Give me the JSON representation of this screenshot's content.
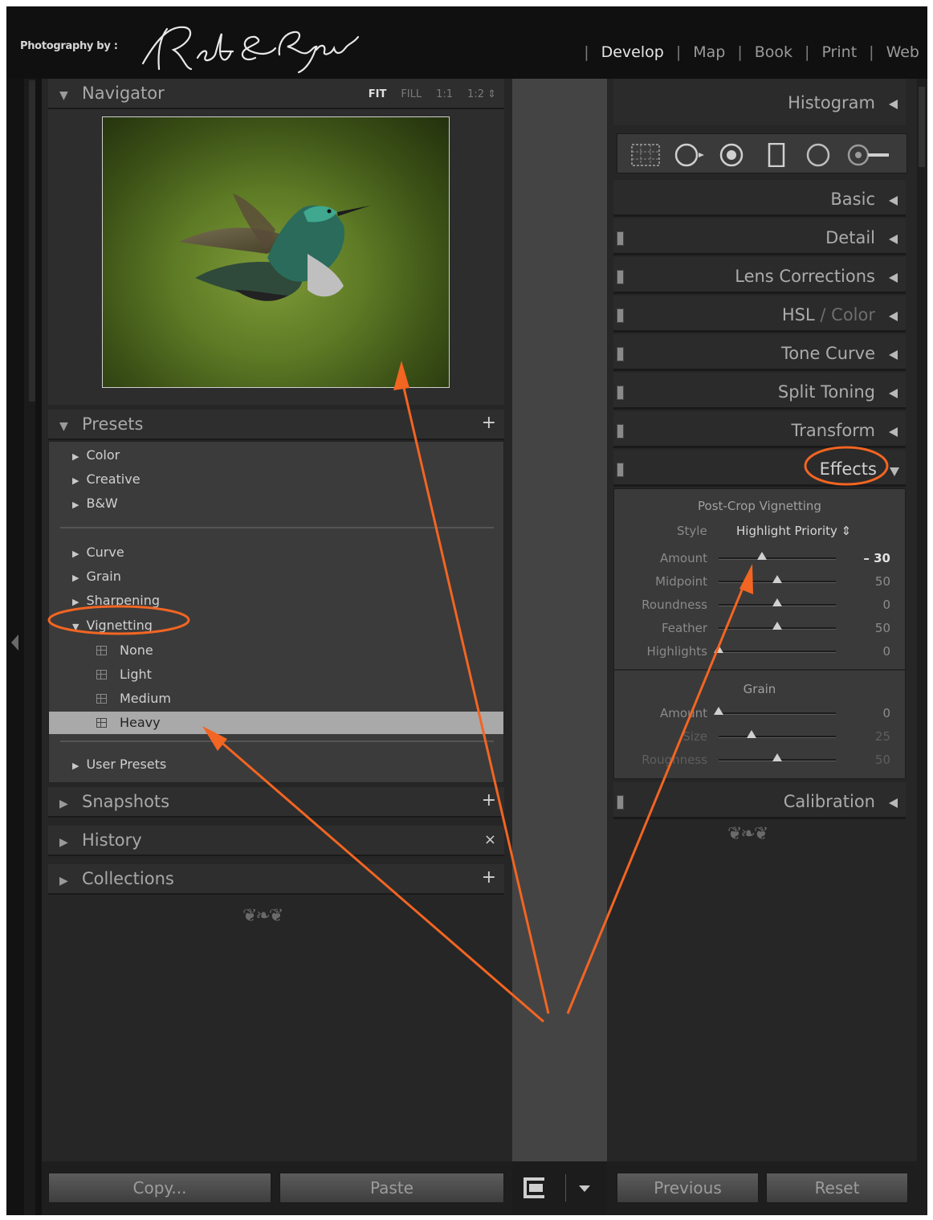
{
  "header": {
    "identity_prefix": "Photography by :",
    "modules": [
      {
        "label": "Develop",
        "active": true
      },
      {
        "label": "Map",
        "active": false
      },
      {
        "label": "Book",
        "active": false
      },
      {
        "label": "Print",
        "active": false
      },
      {
        "label": "Web",
        "active": false
      }
    ]
  },
  "left_panel": {
    "navigator": {
      "title": "Navigator",
      "zoom_options": [
        "FIT",
        "FILL",
        "1:1",
        "1:2 ⇕"
      ],
      "active_zoom": "FIT"
    },
    "presets": {
      "title": "Presets",
      "add_symbol": "+",
      "groups_top": [
        "Color",
        "Creative",
        "B&W"
      ],
      "groups_mid": [
        "Curve",
        "Grain",
        "Sharpening"
      ],
      "expanded_group": "Vignetting",
      "vignetting_items": [
        "None",
        "Light",
        "Medium",
        "Heavy"
      ],
      "selected_item": "Heavy",
      "user_presets": "User Presets"
    },
    "snapshots": {
      "title": "Snapshots",
      "action": "+"
    },
    "history": {
      "title": "History",
      "action": "×"
    },
    "collections": {
      "title": "Collections",
      "action": "+"
    },
    "buttons": {
      "copy": "Copy...",
      "paste": "Paste"
    }
  },
  "right_panel": {
    "headers": {
      "histogram": "Histogram",
      "basic": "Basic",
      "detail": "Detail",
      "lens_corrections": "Lens Corrections",
      "hsl": "HSL",
      "hsl_sep": "/",
      "color": "Color",
      "tone_curve": "Tone Curve",
      "split_toning": "Split Toning",
      "transform": "Transform",
      "effects": "Effects",
      "calibration": "Calibration"
    },
    "tools": [
      "crop-overlay-icon",
      "spot-removal-icon",
      "red-eye-icon",
      "graduated-filter-icon",
      "radial-filter-icon",
      "adjustment-brush-icon"
    ],
    "effects": {
      "post_crop_title": "Post-Crop Vignetting",
      "style_label": "Style",
      "style_value": "Highlight Priority ⇕",
      "vignette_sliders": [
        {
          "label": "Amount",
          "value": "– 30",
          "position": 0.37
        },
        {
          "label": "Midpoint",
          "value": "50",
          "position": 0.5
        },
        {
          "label": "Roundness",
          "value": "0",
          "position": 0.5
        },
        {
          "label": "Feather",
          "value": "50",
          "position": 0.5
        },
        {
          "label": "Highlights",
          "value": "0",
          "position": 0.0
        }
      ],
      "grain_title": "Grain",
      "grain_sliders": [
        {
          "label": "Amount",
          "value": "0",
          "position": 0.0
        },
        {
          "label": "Size",
          "value": "25",
          "position": 0.28
        },
        {
          "label": "Roughness",
          "value": "50",
          "position": 0.5
        }
      ]
    },
    "buttons": {
      "previous": "Previous",
      "reset": "Reset"
    }
  },
  "colors": {
    "annotation": "#f26522",
    "panel": "#262626",
    "center_strip": "#444444"
  }
}
